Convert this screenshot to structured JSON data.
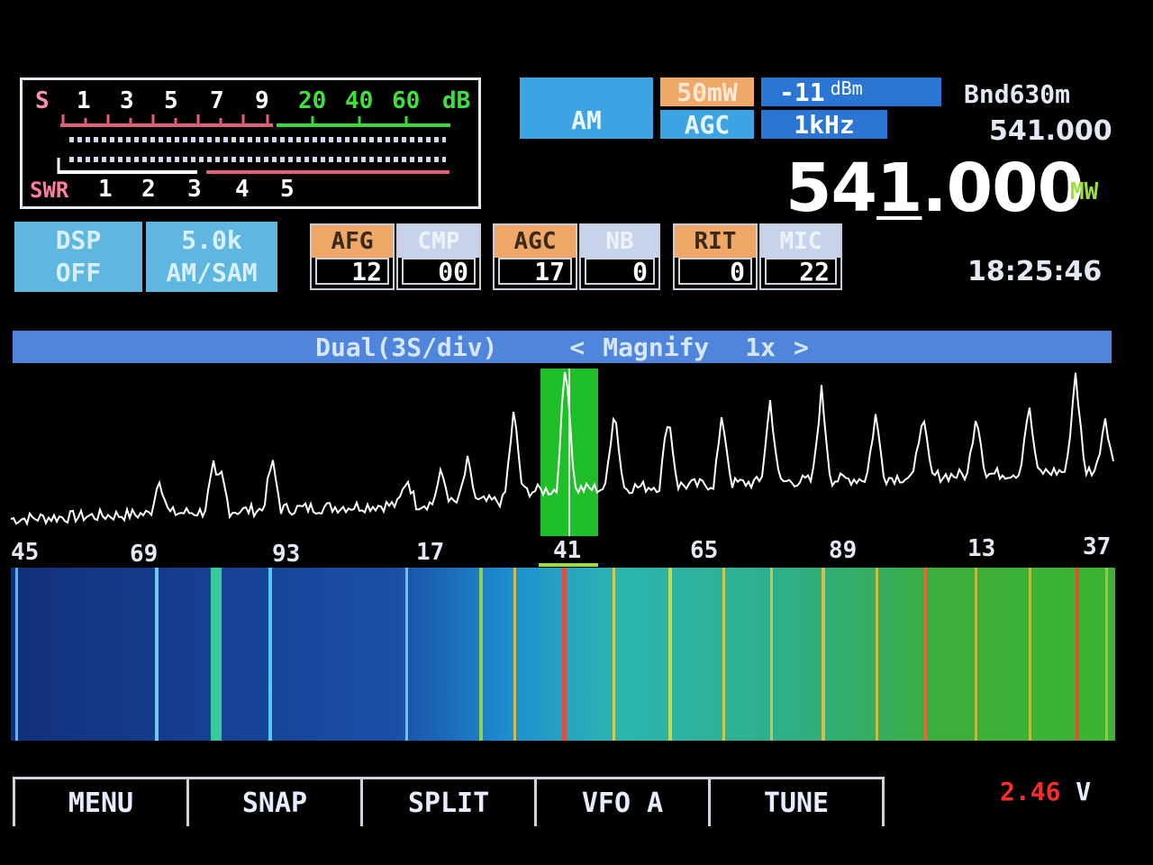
{
  "smeter": {
    "s_labels": [
      "S",
      "1",
      "3",
      "5",
      "7",
      "9"
    ],
    "db_labels": [
      "20",
      "40",
      "60",
      "dB"
    ],
    "swr_labels": [
      "SWR",
      "1",
      "2",
      "3",
      "4",
      "5"
    ]
  },
  "mode": {
    "mode_label": "AM",
    "power": "50mW",
    "agc_label": "AGC",
    "signal_value": "-11",
    "signal_unit": "dBm",
    "step": "1kHz"
  },
  "band": {
    "name": "Bnd630m",
    "sub_frequency": "541.000",
    "main_frequency_prefix": "54",
    "main_frequency_digit": "1",
    "main_frequency_suffix": ".000",
    "band_tag": "MW"
  },
  "dsp": {
    "line1": "DSP",
    "line2": "OFF"
  },
  "filter": {
    "line1": "5.0k",
    "line2": "AM/SAM"
  },
  "params": [
    {
      "name": "AFG",
      "value": "12",
      "active": true
    },
    {
      "name": "CMP",
      "value": "00",
      "active": false
    },
    {
      "name": "AGC",
      "value": "17",
      "active": true
    },
    {
      "name": "NB",
      "value": "0",
      "active": false
    },
    {
      "name": "RIT",
      "value": "0",
      "active": true
    },
    {
      "name": "MIC",
      "value": "22",
      "active": false
    }
  ],
  "clock": "18:25:46",
  "spectrum": {
    "mode_label": "Dual(3S/div)",
    "left_arrow": "<",
    "magnify_label": "Magnify",
    "zoom_level": "1x",
    "right_arrow": ">",
    "freq_ticks": [
      "45",
      "69",
      "93",
      "17",
      "41",
      "65",
      "89",
      "13",
      "37"
    ]
  },
  "buttons": [
    "MENU",
    "SNAP",
    "SPLIT",
    "VFO A",
    "TUNE"
  ],
  "voltage": {
    "value": "2.46",
    "unit": "V"
  },
  "colors": {
    "meter_red": "#e0607a",
    "meter_green": "#38d838",
    "accent_blue": "#3da3e3",
    "accent_orange": "#f0a868",
    "voltage_red": "#ff2a2a",
    "band_tag_green": "#9be03a"
  }
}
